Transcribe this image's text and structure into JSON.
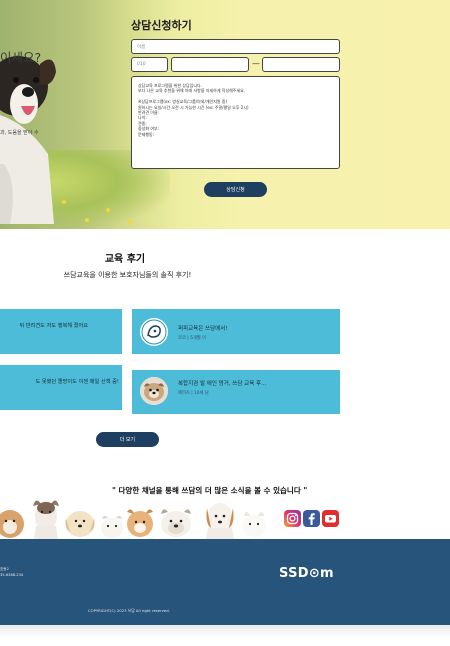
{
  "hero": {
    "left_heading": "이세요?",
    "left_small_text": "과, 도움을 받아 수",
    "form": {
      "title": "상담신청하기",
      "name_placeholder": "이름",
      "phone_prefix_placeholder": "010",
      "phone_separator": "—",
      "message_lines": [
        "상담교육 프로그램을 위한 상담입니다.",
        "보다 나은 교육 추천을 위해 아래 사항을 자세하게 작성해주세요.",
        "",
        "※상담프로그램(ex: 방실교육/그룹/야외/개인지원 중)",
        "원하시는 요일/시간 오전 시 가능한 시간 (ex: 주말/평일 오후 2시)",
        "반려견 이름:",
        "나이:",
        "견종:",
        "중성화 여부:",
        "문제행동:"
      ],
      "submit_label": "상담신청"
    }
  },
  "reviews": {
    "title": "교육 후기",
    "subtitle": "쓰담교육을 이용한 보호자님들의 솔직 후기!",
    "left_cards": [
      {
        "text": "뒤 반려견도 저도 행복해 졌어요"
      },
      {
        "text": "도 못했던 똘망이도 이젠 매일 산책 중!"
      }
    ],
    "right_cards": [
      {
        "title": "퍼피교육은 쓰담에서!",
        "meta": "코코  |  5개월 어"
      },
      {
        "title": "복합지겸 발 애인 멍거, 쓰담 교육 후...",
        "meta": "페이즈  |  10세 남"
      }
    ],
    "more_label": "더 보기"
  },
  "social": {
    "text": "\" 다양한 채널을 통해 쓰담의 더 많은 소식을 볼 수 있습니다 \"",
    "icons": [
      "instagram-icon",
      "facebook-icon",
      "youtube-icon"
    ]
  },
  "footer": {
    "small_lines": [
      "호동2",
      "35-6388-234"
    ],
    "logo": "SSD⊙m",
    "copyright": "COPYRIGHT(C) 2023 쓰담 All right reserved.",
    "color": "#27547a"
  }
}
